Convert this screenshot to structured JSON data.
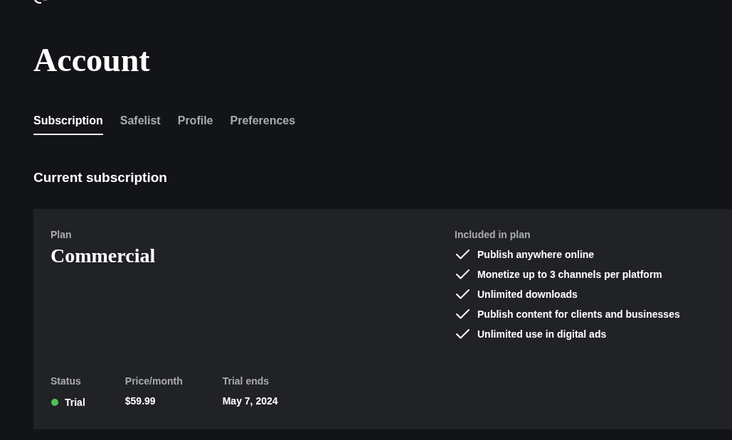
{
  "page": {
    "title": "Account"
  },
  "tabs": [
    {
      "label": "Subscription",
      "selected": true
    },
    {
      "label": "Safelist",
      "selected": false
    },
    {
      "label": "Profile",
      "selected": false
    },
    {
      "label": "Preferences",
      "selected": false
    }
  ],
  "section": {
    "heading": "Current subscription"
  },
  "plan": {
    "label": "Plan",
    "name": "Commercial"
  },
  "stats": [
    {
      "kind": "status",
      "label": "Status",
      "value": "Trial",
      "color": "#4cc35a"
    },
    {
      "kind": "text",
      "label": "Price/month",
      "value": "$59.99"
    },
    {
      "kind": "text",
      "label": "Trial ends",
      "value": "May 7, 2024"
    }
  ],
  "included": {
    "heading": "Included in plan",
    "items": [
      "Publish anywhere online",
      "Monetize up to 3 channels per platform",
      "Unlimited downloads",
      "Publish content for clients and businesses",
      "Unlimited use in digital ads"
    ]
  }
}
